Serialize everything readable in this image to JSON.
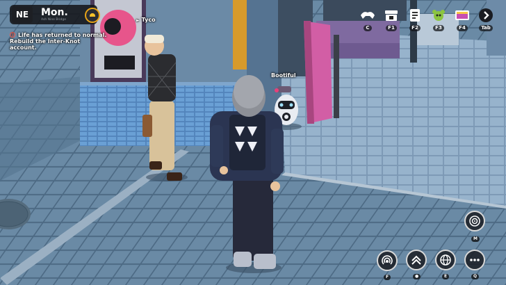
{
  "hud": {
    "day": "Mon.",
    "location_sub": "Ash Nine Bridge",
    "logo": "NE"
  },
  "quest": {
    "line1": "Life has returned to normal.",
    "line2": "Rebuild the Inter-Knot",
    "line3": "account."
  },
  "npcs": {
    "tyco": "Tyco",
    "bootiful": "Bootiful"
  },
  "topbar": [
    {
      "icon": "phone-icon",
      "key": "C"
    },
    {
      "icon": "shop-icon",
      "key": "F1"
    },
    {
      "icon": "notebook-icon",
      "key": "F2"
    },
    {
      "icon": "creature-icon",
      "key": "F3"
    },
    {
      "icon": "tv-icon",
      "key": "F4"
    },
    {
      "icon": "chevron-right-icon",
      "key": "Tab"
    }
  ],
  "actions": {
    "map_key": "M",
    "interact_key": "F",
    "boost_key": "E",
    "globe_key": "Q"
  },
  "colors": {
    "accent_gold": "#e8a417",
    "alert_red": "#ff5a4a",
    "creature_green": "#8bc53f"
  }
}
